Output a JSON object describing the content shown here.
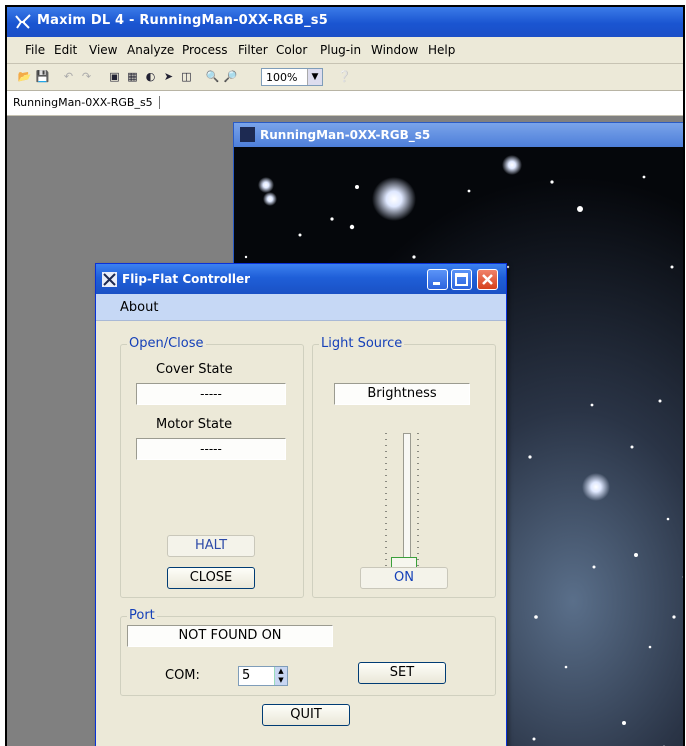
{
  "app": {
    "title": "Maxim DL 4 - RunningMan-0XX-RGB_s5",
    "menu": [
      "File",
      "Edit",
      "View",
      "Analyze",
      "Process",
      "Filter",
      "Color",
      "Plug-in",
      "Window",
      "Help"
    ],
    "zoom": "100%",
    "doc_tab": "RunningMan-0XX-RGB_s5"
  },
  "image_window": {
    "title": "RunningMan-0XX-RGB_s5"
  },
  "dialog": {
    "title": "Flip-Flat Controller",
    "menu_about": "About",
    "open_close": {
      "group_label": "Open/Close",
      "cover_state_label": "Cover State",
      "cover_state_value": "-----",
      "motor_state_label": "Motor State",
      "motor_state_value": "-----",
      "halt_button": "HALT",
      "close_button": "CLOSE"
    },
    "light_source": {
      "group_label": "Light Source",
      "brightness_label": "Brightness",
      "brightness_level": 0,
      "on_button": "ON"
    },
    "port": {
      "group_label": "Port",
      "status": "NOT FOUND ON",
      "com_label": "COM:",
      "com_value": "5",
      "set_button": "SET"
    },
    "quit_button": "QUIT"
  },
  "colors": {
    "titlebar": "#1a55d1",
    "group_label": "#1540b8",
    "dialog_bg": "#ece9d8"
  }
}
